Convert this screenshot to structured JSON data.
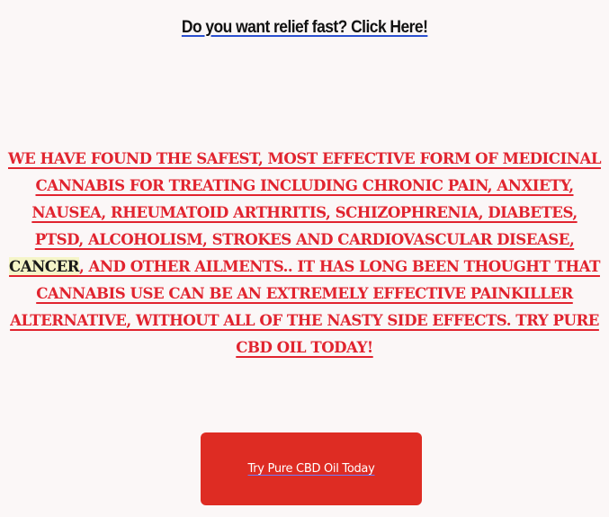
{
  "header": {
    "link_text": "Do you want relief fast? Click Here!"
  },
  "body": {
    "part1": "We have found the safest, most effective form of medicinal cannabis for treating including chronic pain, anxiety, nausea, rheumatoid arthritis, schizophrenia, diabetes, PTSD, alcoholism, strokes and cardiovascular disease, ",
    "highlight": "cancer",
    "part2": ", and other ailments.. It has long been thought that cannabis use can be an extremely effective painkiller alternative, without all of the nasty side effects. Try Pure CBD Oil Today!"
  },
  "cta": {
    "label": "Try Pure CBD Oil Today"
  },
  "colors": {
    "background": "#fbf7f7",
    "body_text": "#e1242f",
    "button": "#de2c23",
    "headline_underline": "#2a4fd0"
  }
}
